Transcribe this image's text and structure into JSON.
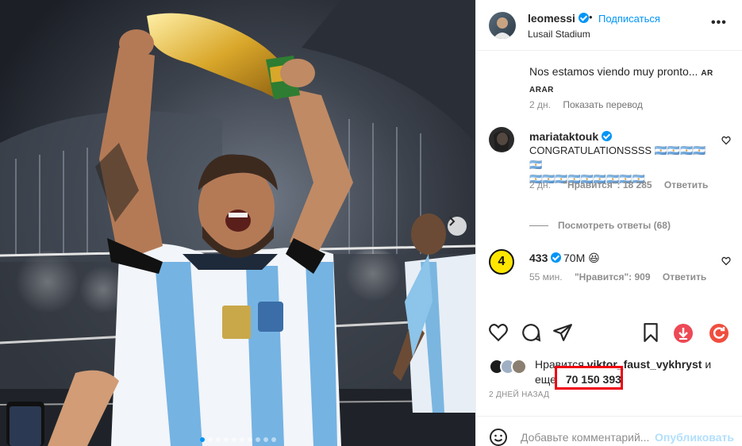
{
  "post": {
    "header": {
      "username": "leomessi",
      "follow_label": "Подписаться",
      "separator": "•",
      "location": "Lusail Stadium",
      "more_label": "•••"
    },
    "comments": [
      {
        "username": "",
        "text": "Nos estamos viendo muy pronto...",
        "flags": "AR ARAR",
        "time": "2 дн.",
        "translate_label": "Показать перевод"
      },
      {
        "username": "mariataktouk",
        "text_line1": "CONGRATULATIONSSSS 🇦🇷🇦🇷🇦🇷🇦🇷🇦🇷",
        "text_line2": "🇦🇷🇦🇷🇦🇷🇦🇷🇦🇷🇦🇷🇦🇷🇦🇷🇦🇷",
        "time": "2 дн.",
        "likes": "\"Нравится\": 18 285",
        "reply_label": "Ответить",
        "view_replies": "Посмотреть ответы (68)"
      },
      {
        "username": "433",
        "avatar_label": "4",
        "text": "70M 😆",
        "time": "55 мин.",
        "likes": "\"Нравится\": 909",
        "reply_label": "Ответить"
      }
    ],
    "likes": {
      "prefix": "Нравится",
      "user": "viktor_faust_vykhryst",
      "and": "и",
      "more": "еще",
      "count": "70 150 393"
    },
    "date": "2 ДНЕЙ НАЗАД",
    "add_comment": {
      "placeholder": "Добавьте комментарий...",
      "post_label": "Опубликовать"
    },
    "colors": {
      "accent": "#0095f6",
      "highlight_border": "#f00010",
      "download_button": "#ed4956",
      "refresh_button": "#f04e3e",
      "badge_433": "#ffe600"
    },
    "icons": [
      "heart-icon",
      "comment-icon",
      "share-icon",
      "bookmark-icon",
      "download-icon",
      "refresh-icon",
      "emoji-icon",
      "chevron-right-icon"
    ]
  }
}
